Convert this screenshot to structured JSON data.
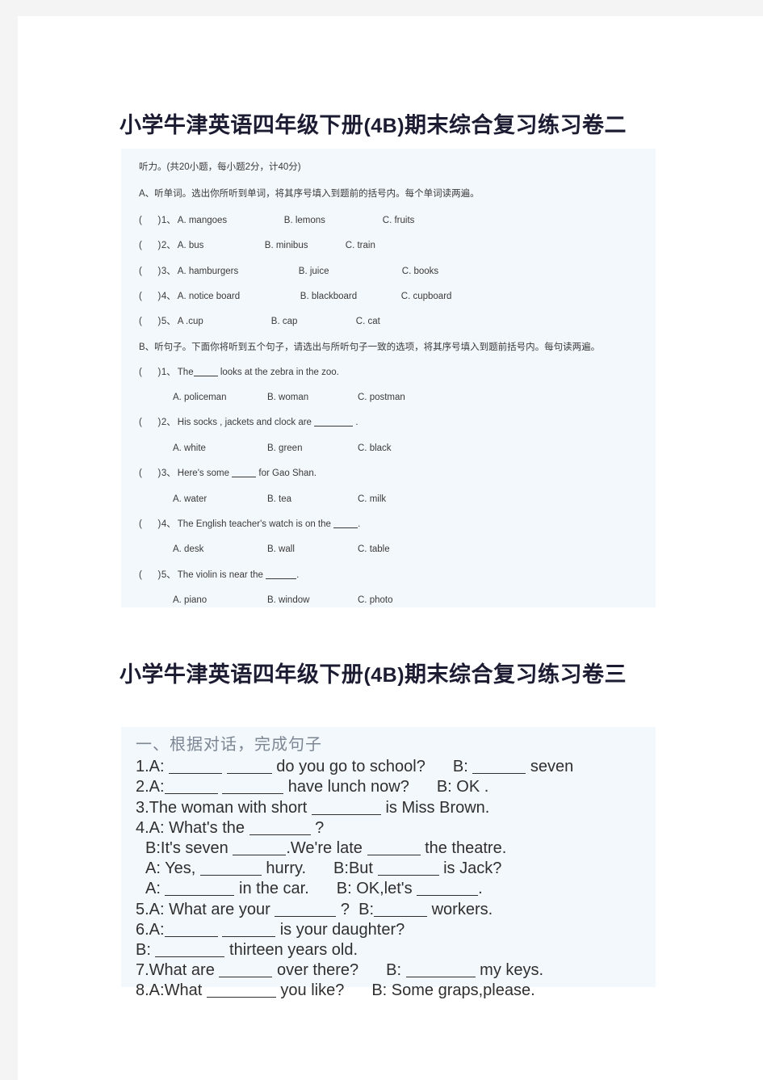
{
  "colors": {
    "page_background": "#f4f4f4",
    "sheet": "#ffffff",
    "content_block": "#f3f8fc",
    "title": "#1b1b32",
    "body_text": "#3a3a3a",
    "section_heading": "#7d8794"
  },
  "titles": {
    "paper_two": {
      "prefix": "小学牛津英语四年级下册",
      "code": "(4B)",
      "suffix": "期末综合复习练习卷二"
    },
    "paper_three": {
      "prefix": "小学牛津英语四年级下册",
      "code": "(4B)",
      "suffix": "期末综合复习练习卷三"
    }
  },
  "listening": {
    "header": "听力。(共20小题，每小题2分，计40分)",
    "part_a_instruction": "A、听单词。选出你所听到单词，将其序号填入到题前的括号内。每个单词读两遍。",
    "part_b_instruction": "B、听句子。下面你将听到五个句子，请选出与所听句子一致的选项，将其序号填入到题前括号内。每句读两遍。",
    "part_a_questions": [
      {
        "paren": "(",
        "close": ")",
        "num": "1、",
        "a": "A. mangoes",
        "b": "B. lemons",
        "c": "C. fruits"
      },
      {
        "paren": "(",
        "close": ")",
        "num": "2、",
        "a": "A. bus",
        "b": "B. minibus",
        "c": "C. train"
      },
      {
        "paren": "(",
        "close": ")",
        "num": "3、",
        "a": "A. hamburgers",
        "b": "B. juice",
        "c": "C. books"
      },
      {
        "paren": "(",
        "close": ")",
        "num": "4、",
        "a": "A. notice board",
        "b": "B. blackboard",
        "c": "C. cupboard"
      },
      {
        "paren": "(",
        "close": ")",
        "num": "5、",
        "a": "A .cup",
        "b": "B. cap",
        "c": "C. cat"
      }
    ],
    "part_b_questions": [
      {
        "paren": "(",
        "close": ")",
        "num": "1、",
        "stem_before": "The",
        "stem_after": "looks  at  the  zebra  in  the  zoo.",
        "a": "A. policeman",
        "b": "B. woman",
        "c": "C. postman"
      },
      {
        "paren": "(",
        "close": ")",
        "num": "2、",
        "stem_before": "His   socks , jackets   and   clock   are",
        "stem_after": ".",
        "a": "A. white",
        "b": "B. green",
        "c": "C. black"
      },
      {
        "paren": "(",
        "close": ")",
        "num": "3、",
        "stem_before": "Here's  some",
        "stem_after": "for  Gao  Shan.",
        "a": "A. water",
        "b": "B. tea",
        "c": "C. milk"
      },
      {
        "paren": "(",
        "close": ")",
        "num": "4、",
        "stem_before": "The  English  teacher's  watch  is  on  the",
        "stem_after": ".",
        "a": "A. desk",
        "b": "B. wall",
        "c": "C. table"
      },
      {
        "paren": "(",
        "close": ")",
        "num": "5、",
        "stem_before": "The  violin  is  near  the",
        "stem_after": ".",
        "a": "A. piano",
        "b": "B. window",
        "c": "C. photo"
      }
    ]
  },
  "dialogue": {
    "heading": "一、根据对话，完成句子",
    "lines": [
      {
        "id": "q1",
        "parts": [
          "1.A:",
          "__",
          "__",
          "do you go to school?",
          "B:",
          "__",
          "seven"
        ]
      },
      {
        "id": "q2",
        "parts": [
          "2.A:",
          "__",
          "__",
          "have lunch now?",
          "B: OK ."
        ]
      },
      {
        "id": "q3",
        "parts": [
          "3.The woman with short",
          "__",
          "is Miss Brown."
        ]
      },
      {
        "id": "q4a",
        "parts": [
          "4.A: What's the",
          "__",
          "?"
        ]
      },
      {
        "id": "q4b",
        "parts": [
          "B:It's seven",
          "__",
          ".We're late",
          "__",
          "the theatre."
        ]
      },
      {
        "id": "q4c",
        "parts": [
          "A: Yes,",
          "__",
          "hurry.",
          "B:But",
          "__",
          "is Jack?"
        ]
      },
      {
        "id": "q4d",
        "parts": [
          "A:",
          "__",
          "in the car.",
          "B: OK,let's",
          "__",
          "."
        ]
      },
      {
        "id": "q5",
        "parts": [
          "5.A: What are your",
          "__",
          "?   B:",
          "__",
          "workers."
        ]
      },
      {
        "id": "q6a",
        "parts": [
          "6.A:",
          "__",
          "__",
          "is your daughter?"
        ]
      },
      {
        "id": "q6b",
        "parts": [
          "B:",
          "__",
          "thirteen years old."
        ]
      },
      {
        "id": "q7",
        "parts": [
          "7.What are",
          "__",
          "over there?",
          "B:",
          "__",
          "my keys."
        ]
      },
      {
        "id": "q8",
        "parts": [
          "8.A:What",
          "__",
          "you like?",
          "B: Some graps,please."
        ]
      }
    ],
    "text": {
      "l1_a": "1.A:",
      "l1_b": "do you go to school?",
      "l1_c": "B:",
      "l1_d": "seven",
      "l2_a": "2.A:",
      "l2_b": "have lunch now?",
      "l2_c": "B: OK .",
      "l3_a": "3.The woman with short",
      "l3_b": "is Miss Brown.",
      "l4_a": "4.A: What's the",
      "l4_b": "?",
      "l5_a": "B:It's seven",
      "l5_b": ".We're late",
      "l5_c": "the theatre.",
      "l6_a": "A: Yes,",
      "l6_b": "hurry.",
      "l6_c": "B:But",
      "l6_d": "is Jack?",
      "l7_a": "A:",
      "l7_b": "in the car.",
      "l7_c": "B: OK,let's",
      "l7_d": ".",
      "l8_a": "5.A: What are your",
      "l8_b": "?",
      "l8_c": "B:",
      "l8_d": "workers.",
      "l9_a": "6.A:",
      "l9_b": "is your daughter?",
      "l10_a": "B:",
      "l10_b": "thirteen years old.",
      "l11_a": "7.What are",
      "l11_b": "over there?",
      "l11_c": "B:",
      "l11_d": "my keys.",
      "l12_a": "8.A:What",
      "l12_b": "you like?",
      "l12_c": "B: Some graps,please."
    }
  }
}
